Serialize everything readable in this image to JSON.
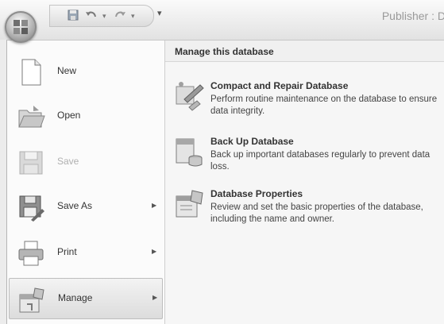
{
  "titlebar": {
    "app_title": "Publisher : D",
    "quick_access": {
      "save_icon": "save-icon",
      "undo_icon": "undo-icon",
      "redo_icon": "redo-icon",
      "customize_icon": "dropdown-icon"
    }
  },
  "menu": {
    "items": [
      {
        "label": "New",
        "icon": "new-document-icon",
        "has_submenu": false,
        "enabled": true
      },
      {
        "label": "Open",
        "icon": "open-folder-icon",
        "has_submenu": false,
        "enabled": true
      },
      {
        "label": "Save",
        "icon": "save-icon",
        "has_submenu": false,
        "enabled": false
      },
      {
        "label": "Save As",
        "icon": "save-as-icon",
        "has_submenu": true,
        "enabled": true
      },
      {
        "label": "Print",
        "icon": "printer-icon",
        "has_submenu": true,
        "enabled": true
      },
      {
        "label": "Manage",
        "icon": "manage-icon",
        "has_submenu": true,
        "enabled": true,
        "selected": true
      }
    ]
  },
  "submenu": {
    "header": "Manage this database",
    "options": [
      {
        "title": "Compact and Repair Database",
        "description": "Perform routine maintenance on the database to ensure data integrity.",
        "icon": "compact-repair-icon"
      },
      {
        "title": "Back Up Database",
        "description": "Back up important databases regularly to prevent data loss.",
        "icon": "backup-database-icon"
      },
      {
        "title": "Database Properties",
        "description": "Review and set the basic properties of the database, including the name and owner.",
        "icon": "database-properties-icon"
      }
    ]
  }
}
